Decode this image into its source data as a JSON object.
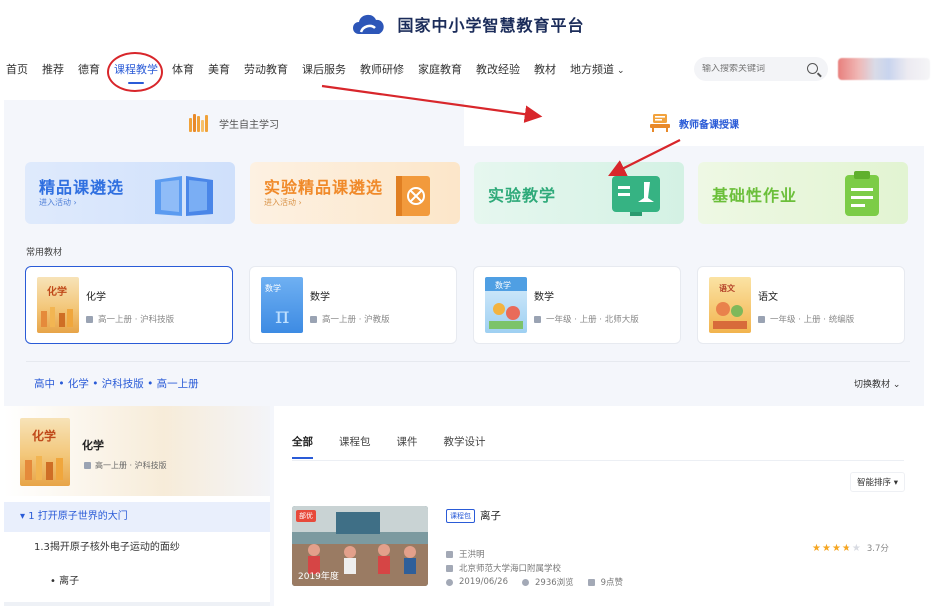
{
  "header": {
    "site_title": "国家中小学智慧教育平台",
    "logo_icon": "cloud-logo-icon"
  },
  "nav": {
    "items": [
      "首页",
      "推荐",
      "德育",
      "课程教学",
      "体育",
      "美育",
      "劳动教育",
      "课后服务",
      "教师研修",
      "家庭教育",
      "教改经验",
      "教材",
      "地方频道"
    ],
    "active_index": 3,
    "search_placeholder": "输入搜索关键词",
    "accent": "#2a5bd7"
  },
  "mode_tabs": [
    {
      "label": "学生自主学习",
      "icon": "books-icon",
      "active": false
    },
    {
      "label": "教师备课授课",
      "icon": "teacher-desk-icon",
      "active": true
    }
  ],
  "feature_cards": [
    {
      "title": "精品课遴选",
      "sub": "进入活动 ›",
      "color": "#2f6fe0",
      "bg": "#e3eefc",
      "icon": "open-book-icon"
    },
    {
      "title": "实验精品课遴选",
      "sub": "进入活动 ›",
      "color": "#f08a2a",
      "bg": "#fdf0df",
      "icon": "flask-book-icon"
    },
    {
      "title": "实验教学",
      "sub": "",
      "color": "#2faa7a",
      "bg": "#e3f5ee",
      "icon": "microscope-board-icon"
    },
    {
      "title": "基础性作业",
      "sub": "",
      "color": "#6bbf3a",
      "bg": "#eaf7e0",
      "icon": "clipboard-icon"
    }
  ],
  "common_label": "常用教材",
  "textbooks": [
    {
      "name": "化学",
      "meta": "高一上册 · 沪科技版",
      "selected": true,
      "cover": "chemistry"
    },
    {
      "name": "数学",
      "meta": "高一上册 · 沪教版",
      "selected": false,
      "cover": "math-blue"
    },
    {
      "name": "数学",
      "meta": "一年级 · 上册 · 北师大版",
      "selected": false,
      "cover": "math-kids"
    },
    {
      "name": "语文",
      "meta": "一年级 · 上册 · 统编版",
      "selected": false,
      "cover": "chinese"
    }
  ],
  "breadcrumb": "高中 • 化学 • 沪科技版 • 高一上册",
  "switch_label": "切换教材",
  "left_book": {
    "name": "化学",
    "meta": "高一上册 · 沪科技版"
  },
  "tree": {
    "chapter": "▾ 1 打开原子世界的大门",
    "section": "1.3揭开原子核外电子运动的面纱",
    "lesson": "•  离子"
  },
  "result_tabs": [
    "全部",
    "课程包",
    "课件",
    "教学设计"
  ],
  "sort_label": "智能排序",
  "resource": {
    "tag": "部优",
    "year": "2019年度",
    "badge": "课程包",
    "title": "离子",
    "teacher": "王洪明",
    "school": "北京师范大学海口附属学校",
    "date": "2019/06/26",
    "views": "2936浏览",
    "likes": "9点赞",
    "rating": 3.7,
    "rating_text": "3.7分"
  }
}
